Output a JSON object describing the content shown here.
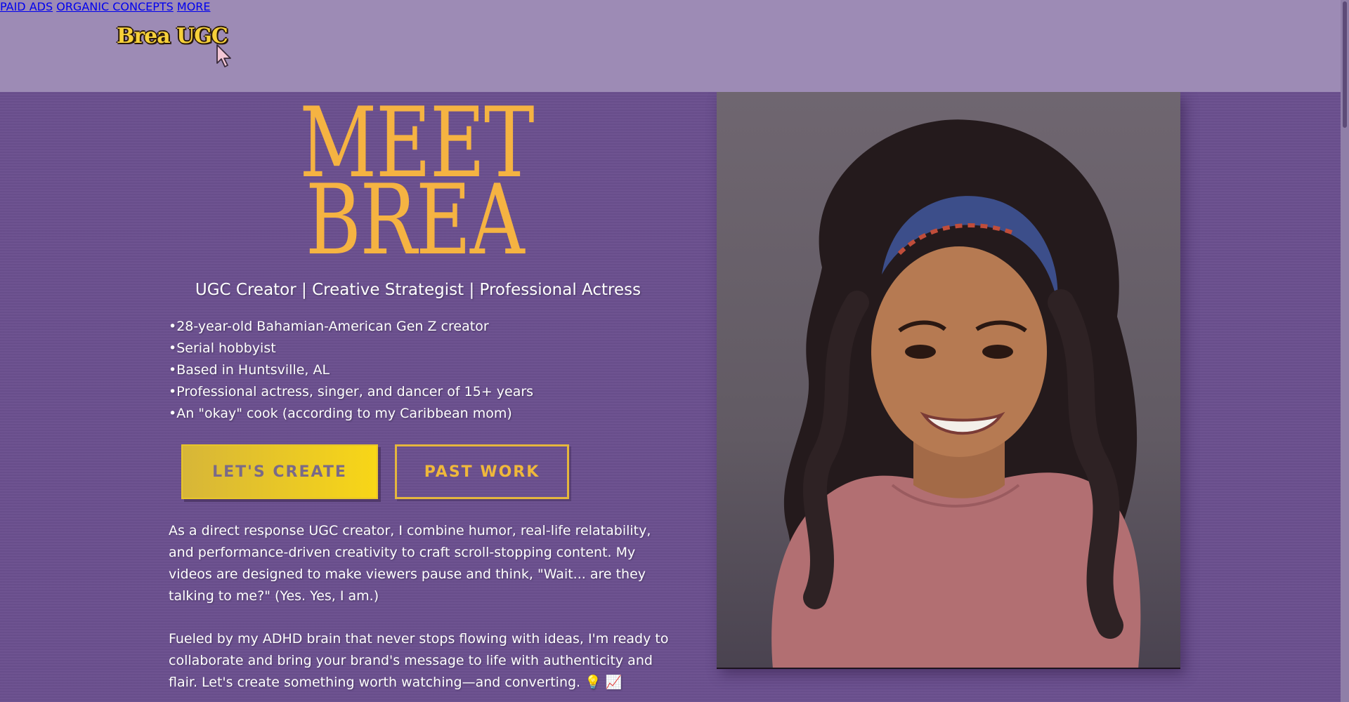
{
  "header": {
    "logo_text": "Brea UGC",
    "nav": [
      "PAID ADS",
      "ORGANIC CONCEPTS",
      "MORE"
    ]
  },
  "hero": {
    "title_line1": "MEET",
    "title_line2": "BREA",
    "subtitle": "UGC Creator | Creative Strategist | Professional Actress",
    "bullets": [
      "•28-year-old Bahamian-American Gen Z creator",
      "•Serial hobbyist",
      "•Based in Huntsville, AL",
      "•Professional actress, singer, and dancer of 15+ years",
      "•An \"okay\" cook (according to my Caribbean mom)"
    ],
    "buttons": {
      "create": "LET'S CREATE",
      "past_work": "PAST WORK"
    },
    "paragraphs": [
      "As a direct response UGC creator, I combine humor, real-life relatability, and performance-driven creativity to craft scroll-stopping content. My videos are designed to make viewers pause and think, \"Wait... are they talking to me?\" (Yes. Yes, I am.)",
      "Fueled by my ADHD brain that never stops flowing with ideas, I'm ready to collaborate and bring your brand's message to life with authenticity and flair. Let's create something worth watching—and converting. 💡 📈"
    ]
  },
  "icons": {
    "cursor": "arrow-cursor-icon"
  },
  "colors": {
    "background": "#6a4f8e",
    "header": "#9d8bb5",
    "title": "#f5b342",
    "accent_yellow": "#f8d617"
  }
}
